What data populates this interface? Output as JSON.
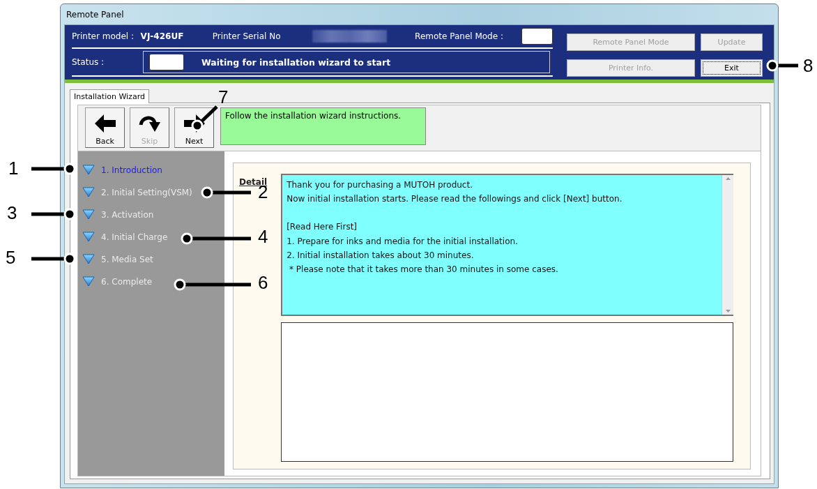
{
  "window": {
    "title": "Remote Panel"
  },
  "header": {
    "model_label": "Printer model :",
    "model": "VJ-426UF",
    "serial_label": "Printer Serial No",
    "mode_label": "Remote Panel Mode :",
    "status_label": "Status :",
    "status": "Waiting for installation wizard to start"
  },
  "buttons": [
    {
      "label": "Remote Panel Mode",
      "disabled": true
    },
    {
      "label": "Update",
      "disabled": true
    },
    {
      "label": "Printer Info.",
      "disabled": true
    },
    {
      "label": "Exit",
      "disabled": false
    }
  ],
  "tabs": [
    {
      "label": "Installation Wizard",
      "selected": true
    }
  ],
  "toolbar": [
    {
      "label": "Back",
      "kind": "back",
      "disabled": false
    },
    {
      "label": "Skip",
      "kind": "skip",
      "disabled": true
    },
    {
      "label": "Next",
      "kind": "next",
      "disabled": false
    }
  ],
  "message": "Follow the installation wizard instructions.",
  "steps": [
    {
      "label": "1. Introduction",
      "selected": true
    },
    {
      "label": "2. Initial Setting(VSM)",
      "selected": false
    },
    {
      "label": "3. Activation",
      "selected": false
    },
    {
      "label": "4. Initial Charge",
      "selected": false
    },
    {
      "label": "5. Media Set",
      "selected": false
    },
    {
      "label": "6. Complete",
      "selected": false
    }
  ],
  "detail": {
    "label": "Detail",
    "paragraphs": [
      [
        "Thank you for purchasing a MUTOH product.",
        "Now initial installation starts. Please read the followings and click [Next] button."
      ],
      [
        "[Read Here First]",
        "1. Prepare for inks and media for the initial installation.",
        "2. Initial installation takes about 30 minutes.",
        " * Please note that it takes more than 30 minutes in some cases."
      ]
    ]
  },
  "callouts": [
    "1",
    "2",
    "3",
    "4",
    "5",
    "6",
    "7",
    "8"
  ]
}
